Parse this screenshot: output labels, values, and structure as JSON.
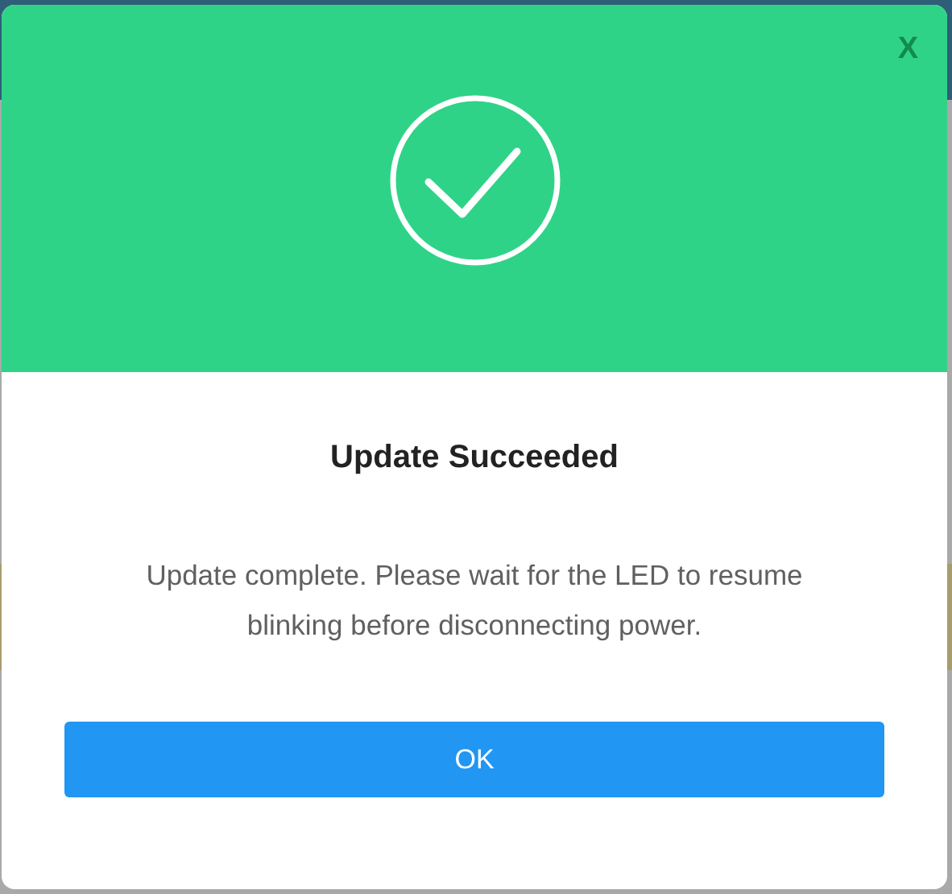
{
  "dialog": {
    "close_label": "X",
    "title": "Update Succeeded",
    "message": "Update complete. Please wait for the LED to resume blinking before disconnecting power.",
    "buttons": [
      "OK"
    ]
  }
}
